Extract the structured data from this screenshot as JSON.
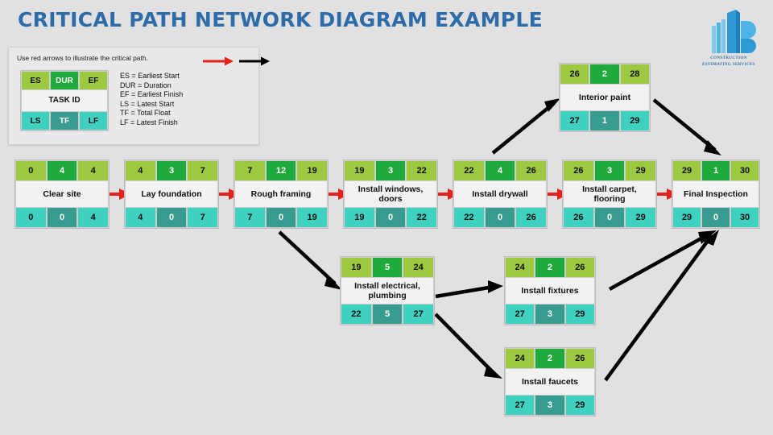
{
  "page": {
    "title": "CRITICAL PATH NETWORK DIAGRAM EXAMPLE",
    "background_color": "#e1e1e1",
    "title_color": "#2d6ca8"
  },
  "logo": {
    "name": "construction-estimating-services-logo",
    "line1": "CONSTRUCTION",
    "line2": "ESTIMATING SERVICES",
    "color": "#2e9ad6"
  },
  "legend": {
    "note": "Use red arrows to illustrate the critical path.",
    "red_arrow_label": "red-arrow",
    "black_arrow_label": "black-arrow",
    "sample_node": {
      "es": "ES",
      "dur": "DUR",
      "ef": "EF",
      "task_id": "TASK ID",
      "ls": "LS",
      "tf": "TF",
      "lf": "LF"
    },
    "definitions": [
      "ES = Earliest Start",
      "DUR = Duration",
      "EF = Earliest Finish",
      "LS = Latest Start",
      "TF = Total Float",
      "LF = Latest Finish"
    ]
  },
  "colors": {
    "es_ef": "#9cc93f",
    "dur": "#1faa3c",
    "ls_lf": "#3fd0c0",
    "tf": "#389d90",
    "task_label": "#f2f2f2",
    "critical_arrow": "#e8211c",
    "normal_arrow": "#000000"
  },
  "nodes": [
    {
      "id": "clear-site",
      "label": "Clear site",
      "es": "0",
      "dur": "4",
      "ef": "4",
      "ls": "0",
      "tf": "0",
      "lf": "4"
    },
    {
      "id": "lay-foundation",
      "label": "Lay foundation",
      "es": "4",
      "dur": "3",
      "ef": "7",
      "ls": "4",
      "tf": "0",
      "lf": "7"
    },
    {
      "id": "rough-framing",
      "label": "Rough framing",
      "es": "7",
      "dur": "12",
      "ef": "19",
      "ls": "7",
      "tf": "0",
      "lf": "19"
    },
    {
      "id": "install-windows-doors",
      "label": "Install windows, doors",
      "es": "19",
      "dur": "3",
      "ef": "22",
      "ls": "19",
      "tf": "0",
      "lf": "22"
    },
    {
      "id": "install-drywall",
      "label": "Install drywall",
      "es": "22",
      "dur": "4",
      "ef": "26",
      "ls": "22",
      "tf": "0",
      "lf": "26"
    },
    {
      "id": "install-carpet-flooring",
      "label": "Install carpet, flooring",
      "es": "26",
      "dur": "3",
      "ef": "29",
      "ls": "26",
      "tf": "0",
      "lf": "29"
    },
    {
      "id": "final-inspection",
      "label": "Final Inspection",
      "es": "29",
      "dur": "1",
      "ef": "30",
      "ls": "29",
      "tf": "0",
      "lf": "30"
    },
    {
      "id": "interior-paint",
      "label": "Interior paint",
      "es": "26",
      "dur": "2",
      "ef": "28",
      "ls": "27",
      "tf": "1",
      "lf": "29"
    },
    {
      "id": "install-electrical-plumbing",
      "label": "Install electrical, plumbing",
      "es": "19",
      "dur": "5",
      "ef": "24",
      "ls": "22",
      "tf": "5",
      "lf": "27"
    },
    {
      "id": "install-fixtures",
      "label": "Install fixtures",
      "es": "24",
      "dur": "2",
      "ef": "26",
      "ls": "27",
      "tf": "3",
      "lf": "29"
    },
    {
      "id": "install-faucets",
      "label": "Install faucets",
      "es": "24",
      "dur": "2",
      "ef": "26",
      "ls": "27",
      "tf": "3",
      "lf": "29"
    }
  ],
  "chart_data": {
    "type": "diagram",
    "diagram_kind": "critical-path-network-diagram",
    "title": "CRITICAL PATH NETWORK DIAGRAM EXAMPLE",
    "field_order": [
      "ES",
      "DUR",
      "EF",
      "TASK ID",
      "LS",
      "TF",
      "LF"
    ],
    "tasks": [
      {
        "name": "Clear site",
        "ES": 0,
        "DUR": 4,
        "EF": 4,
        "LS": 0,
        "TF": 0,
        "LF": 4,
        "critical": true
      },
      {
        "name": "Lay foundation",
        "ES": 4,
        "DUR": 3,
        "EF": 7,
        "LS": 4,
        "TF": 0,
        "LF": 7,
        "critical": true
      },
      {
        "name": "Rough framing",
        "ES": 7,
        "DUR": 12,
        "EF": 19,
        "LS": 7,
        "TF": 0,
        "LF": 19,
        "critical": true
      },
      {
        "name": "Install windows, doors",
        "ES": 19,
        "DUR": 3,
        "EF": 22,
        "LS": 19,
        "TF": 0,
        "LF": 22,
        "critical": true
      },
      {
        "name": "Install drywall",
        "ES": 22,
        "DUR": 4,
        "EF": 26,
        "LS": 22,
        "TF": 0,
        "LF": 26,
        "critical": true
      },
      {
        "name": "Install carpet, flooring",
        "ES": 26,
        "DUR": 3,
        "EF": 29,
        "LS": 26,
        "TF": 0,
        "LF": 29,
        "critical": true
      },
      {
        "name": "Final Inspection",
        "ES": 29,
        "DUR": 1,
        "EF": 30,
        "LS": 29,
        "TF": 0,
        "LF": 30,
        "critical": true
      },
      {
        "name": "Interior paint",
        "ES": 26,
        "DUR": 2,
        "EF": 28,
        "LS": 27,
        "TF": 1,
        "LF": 29,
        "critical": false
      },
      {
        "name": "Install electrical, plumbing",
        "ES": 19,
        "DUR": 5,
        "EF": 24,
        "LS": 22,
        "TF": 5,
        "LF": 27,
        "critical": false
      },
      {
        "name": "Install fixtures",
        "ES": 24,
        "DUR": 2,
        "EF": 26,
        "LS": 27,
        "TF": 3,
        "LF": 29,
        "critical": false
      },
      {
        "name": "Install faucets",
        "ES": 24,
        "DUR": 2,
        "EF": 26,
        "LS": 27,
        "TF": 3,
        "LF": 29,
        "critical": false
      }
    ],
    "edges": [
      {
        "from": "Clear site",
        "to": "Lay foundation",
        "type": "critical"
      },
      {
        "from": "Lay foundation",
        "to": "Rough framing",
        "type": "critical"
      },
      {
        "from": "Rough framing",
        "to": "Install windows, doors",
        "type": "critical"
      },
      {
        "from": "Install windows, doors",
        "to": "Install drywall",
        "type": "critical"
      },
      {
        "from": "Install drywall",
        "to": "Install carpet, flooring",
        "type": "critical"
      },
      {
        "from": "Install carpet, flooring",
        "to": "Final Inspection",
        "type": "critical"
      },
      {
        "from": "Install drywall",
        "to": "Interior paint",
        "type": "normal"
      },
      {
        "from": "Interior paint",
        "to": "Final Inspection",
        "type": "normal"
      },
      {
        "from": "Rough framing",
        "to": "Install electrical, plumbing",
        "type": "normal"
      },
      {
        "from": "Install electrical, plumbing",
        "to": "Install fixtures",
        "type": "normal"
      },
      {
        "from": "Install electrical, plumbing",
        "to": "Install faucets",
        "type": "normal"
      },
      {
        "from": "Install fixtures",
        "to": "Final Inspection",
        "type": "normal"
      },
      {
        "from": "Install faucets",
        "to": "Final Inspection",
        "type": "normal"
      }
    ],
    "project_duration": 30,
    "critical_path": [
      "Clear site",
      "Lay foundation",
      "Rough framing",
      "Install windows, doors",
      "Install drywall",
      "Install carpet, flooring",
      "Final Inspection"
    ]
  }
}
